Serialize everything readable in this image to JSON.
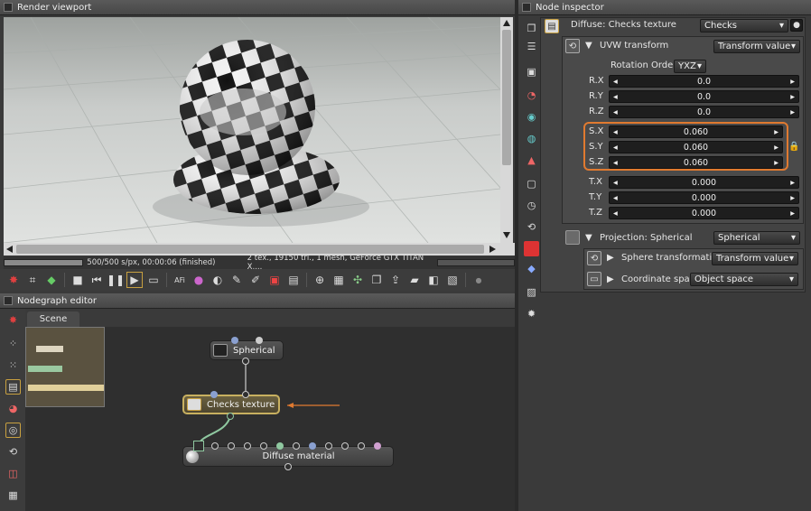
{
  "viewport": {
    "title": "Render viewport",
    "status_left": "500/500 s/px, 00:00:06 (finished)",
    "status_right": "2 tex., 19150 tri., 1 mesh, GeForce GTX TITAN X,..."
  },
  "nodegraph": {
    "title": "Nodegraph editor",
    "tab": "Scene",
    "nodes": {
      "spherical": "Spherical",
      "checks": "Checks texture",
      "diffuse": "Diffuse material"
    }
  },
  "inspector": {
    "title": "Node inspector",
    "header_label": "Diffuse: Checks texture",
    "header_value": "Checks",
    "uvw": {
      "label": "UVW transform",
      "value": "Transform value",
      "rotation_order_label": "Rotation Order",
      "rotation_order_value": "YXZ"
    },
    "fields": [
      {
        "label": "R.X",
        "value": "0.0"
      },
      {
        "label": "R.Y",
        "value": "0.0"
      },
      {
        "label": "R.Z",
        "value": "0.0"
      },
      {
        "label": "S.X",
        "value": "0.060"
      },
      {
        "label": "S.Y",
        "value": "0.060"
      },
      {
        "label": "S.Z",
        "value": "0.060"
      },
      {
        "label": "T.X",
        "value": "0.000"
      },
      {
        "label": "T.Y",
        "value": "0.000"
      },
      {
        "label": "T.Z",
        "value": "0.000"
      }
    ],
    "projection": {
      "label": "Projection: Spherical",
      "value": "Spherical"
    },
    "sphere_transform": {
      "label": "Sphere transformation",
      "value": "Transform value"
    },
    "coord_space": {
      "label": "Coordinate space:",
      "value": "Object space"
    }
  },
  "colors": {
    "highlight": "#e07a30",
    "node_selected": "#c8b060",
    "pin_green": "#8fc8a0",
    "pin_blue": "#8aa0d0",
    "pin_pink": "#d0a0d0"
  }
}
